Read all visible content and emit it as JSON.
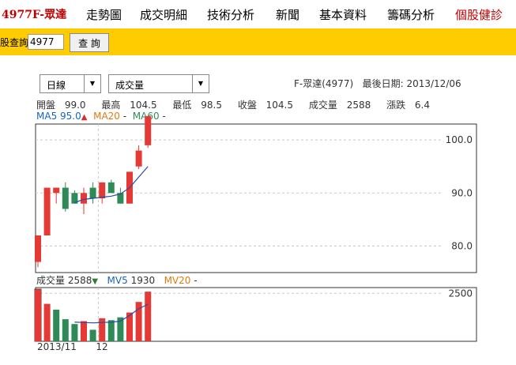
{
  "nav": {
    "title": "4977F-眾達",
    "items": [
      "走勢圖",
      "成交明細",
      "技術分析",
      "新聞",
      "基本資料",
      "籌碼分析",
      "個股健診"
    ]
  },
  "query": {
    "label": "股查詢",
    "value": "4977",
    "button": "查 詢"
  },
  "controls": {
    "period": "日線",
    "indicator": "成交量",
    "stock_label": "F-眾達(4977)",
    "last_date_label": "最後日期:",
    "last_date": "2013/12/06"
  },
  "ohlc": {
    "open_label": "開盤",
    "open": "99.0",
    "high_label": "最高",
    "high": "104.5",
    "low_label": "最低",
    "low": "98.5",
    "close_label": "收盤",
    "close": "104.5",
    "volume_label": "成交量",
    "volume": "2588",
    "change_label": "漲跌",
    "change": "6.4"
  },
  "ma": {
    "ma5_label": "MA5",
    "ma5_value": "95.0",
    "ma20_label": "MA20",
    "ma20_value": "-",
    "ma60_label": "MA60",
    "ma60_value": "-"
  },
  "volume_info": {
    "label": "成交量",
    "value": "2588",
    "mv5_label": "MV5",
    "mv5_value": "1930",
    "mv20_label": "MV20",
    "mv20_value": "-"
  },
  "colors": {
    "up": "#e53935",
    "down": "#2e8b57",
    "ma5": "#2a4aa0",
    "grid": "#c8c8c8",
    "nav_accent": "#c00000",
    "query_bar": "#ffcc00"
  },
  "chart_data": [
    {
      "type": "candlestick",
      "y_ticks": [
        "100.0",
        "90.0",
        "80.0"
      ],
      "ylim": [
        75,
        103
      ],
      "grid": true,
      "candles": [
        {
          "open": 77,
          "high": 80,
          "low": 76,
          "close": 82
        },
        {
          "open": 82,
          "high": 91,
          "low": 82,
          "close": 91
        },
        {
          "open": 90,
          "high": 91,
          "low": 88,
          "close": 91
        },
        {
          "open": 91,
          "high": 92,
          "low": 86.5,
          "close": 87
        },
        {
          "open": 90,
          "high": 90.5,
          "low": 88,
          "close": 88
        },
        {
          "open": 88,
          "high": 91,
          "low": 86,
          "close": 90
        },
        {
          "open": 91,
          "high": 92,
          "low": 88,
          "close": 89
        },
        {
          "open": 89,
          "high": 92,
          "low": 88,
          "close": 92
        },
        {
          "open": 92,
          "high": 92.5,
          "low": 90,
          "close": 90
        },
        {
          "open": 90,
          "high": 91,
          "low": 88,
          "close": 88
        },
        {
          "open": 88,
          "high": 94,
          "low": 88,
          "close": 94
        },
        {
          "open": 95,
          "high": 99,
          "low": 94.5,
          "close": 98
        },
        {
          "open": 99,
          "high": 104.5,
          "low": 98.5,
          "close": 104.5
        }
      ],
      "ma5": [
        null,
        null,
        null,
        null,
        88.2,
        88.8,
        89.0,
        89.2,
        89.4,
        89.8,
        91.0,
        93.0,
        95.0
      ]
    },
    {
      "type": "bar",
      "x_tick_labels": [
        "2013/11",
        "12"
      ],
      "y_ticks": [
        "2500"
      ],
      "ylim": [
        0,
        2800
      ],
      "volumes": [
        2700,
        1950,
        1650,
        1150,
        900,
        1050,
        600,
        1200,
        1100,
        1250,
        1500,
        2050,
        2588
      ],
      "directions": [
        "up",
        "up",
        "down",
        "down",
        "down",
        "up",
        "down",
        "up",
        "down",
        "down",
        "up",
        "up",
        "up"
      ],
      "mv5": [
        null,
        null,
        null,
        null,
        1000,
        980,
        960,
        980,
        1000,
        1050,
        1350,
        1700,
        1930
      ]
    }
  ]
}
